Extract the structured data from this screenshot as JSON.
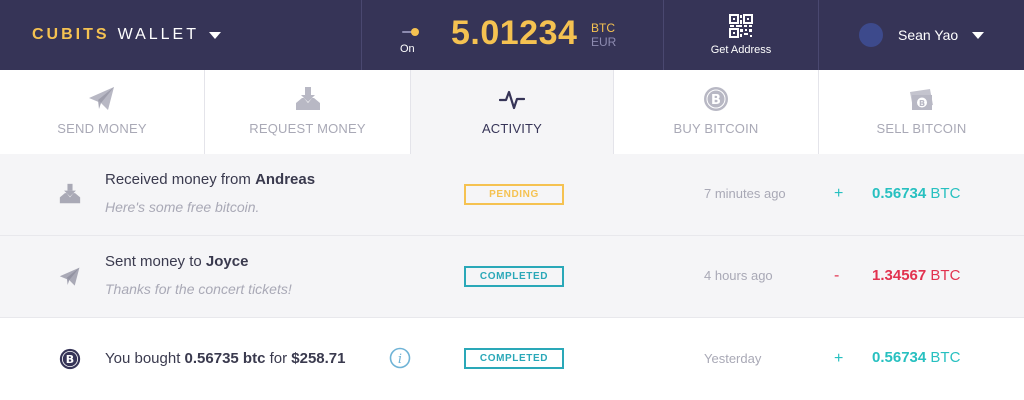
{
  "colors": {
    "header_bg": "#363457",
    "accent_gold": "#f5c251",
    "positive": "#27c0c0",
    "negative": "#e2324f",
    "completed": "#2aa8b8"
  },
  "header": {
    "brand_part1": "CUBITS",
    "brand_part2": "WALLET",
    "toggle_label": "On",
    "balance": "5.01234",
    "currency_primary": "BTC",
    "currency_secondary": "EUR",
    "get_address_label": "Get Address",
    "user_name": "Sean Yao"
  },
  "tabs": [
    {
      "label": "SEND MONEY",
      "icon": "paper-plane-icon",
      "active": false
    },
    {
      "label": "REQUEST MONEY",
      "icon": "download-tray-icon",
      "active": false
    },
    {
      "label": "ACTIVITY",
      "icon": "pulse-icon",
      "active": true
    },
    {
      "label": "BUY BITCOIN",
      "icon": "bitcoin-coin-icon",
      "active": false
    },
    {
      "label": "SELL BITCOIN",
      "icon": "cash-bitcoin-icon",
      "active": false
    }
  ],
  "activity": [
    {
      "icon": "download-tray-icon",
      "title_prefix": "Received money from ",
      "title_bold": "Andreas",
      "note": "Here's some free bitcoin.",
      "status": "PENDING",
      "time": "7 minutes ago",
      "sign": "+",
      "amount": "0.56734",
      "unit": "BTC"
    },
    {
      "icon": "paper-plane-icon",
      "title_prefix": "Sent money to ",
      "title_bold": "Joyce",
      "note": "Thanks for the concert tickets!",
      "status": "COMPLETED",
      "time": "4 hours ago",
      "sign": "-",
      "amount": "1.34567",
      "unit": "BTC"
    },
    {
      "icon": "bitcoin-coin-icon",
      "title_prefix": "You bought ",
      "title_bold": "0.56735 btc",
      "title_mid": " for ",
      "title_bold2": "$258.71",
      "status": "COMPLETED",
      "time": "Yesterday",
      "sign": "+",
      "amount": "0.56734",
      "unit": "BTC"
    }
  ]
}
